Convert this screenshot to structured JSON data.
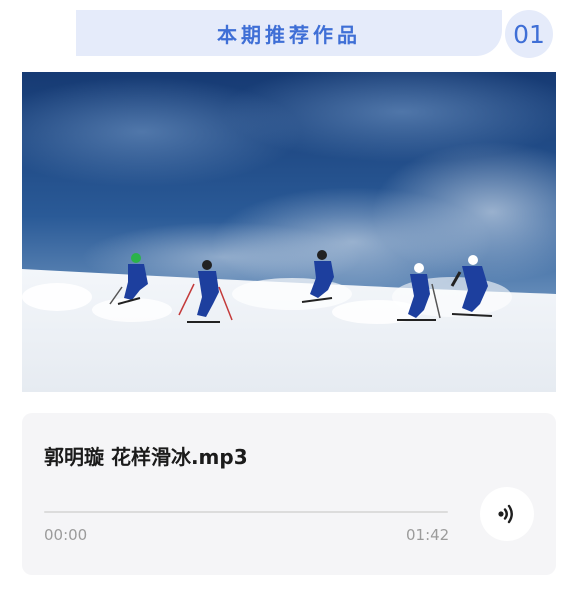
{
  "header": {
    "title": "本期推荐作品",
    "number": "01",
    "accent_color": "#3f6fd6",
    "banner_color": "#e5ebfa"
  },
  "photo": {
    "description_icon": "skiers-photo"
  },
  "audio": {
    "title": "郭明璇 花样滑冰.mp3",
    "current_time": "00:00",
    "total_time": "01:42",
    "progress": 0,
    "play_icon": "sound-wave-icon"
  }
}
